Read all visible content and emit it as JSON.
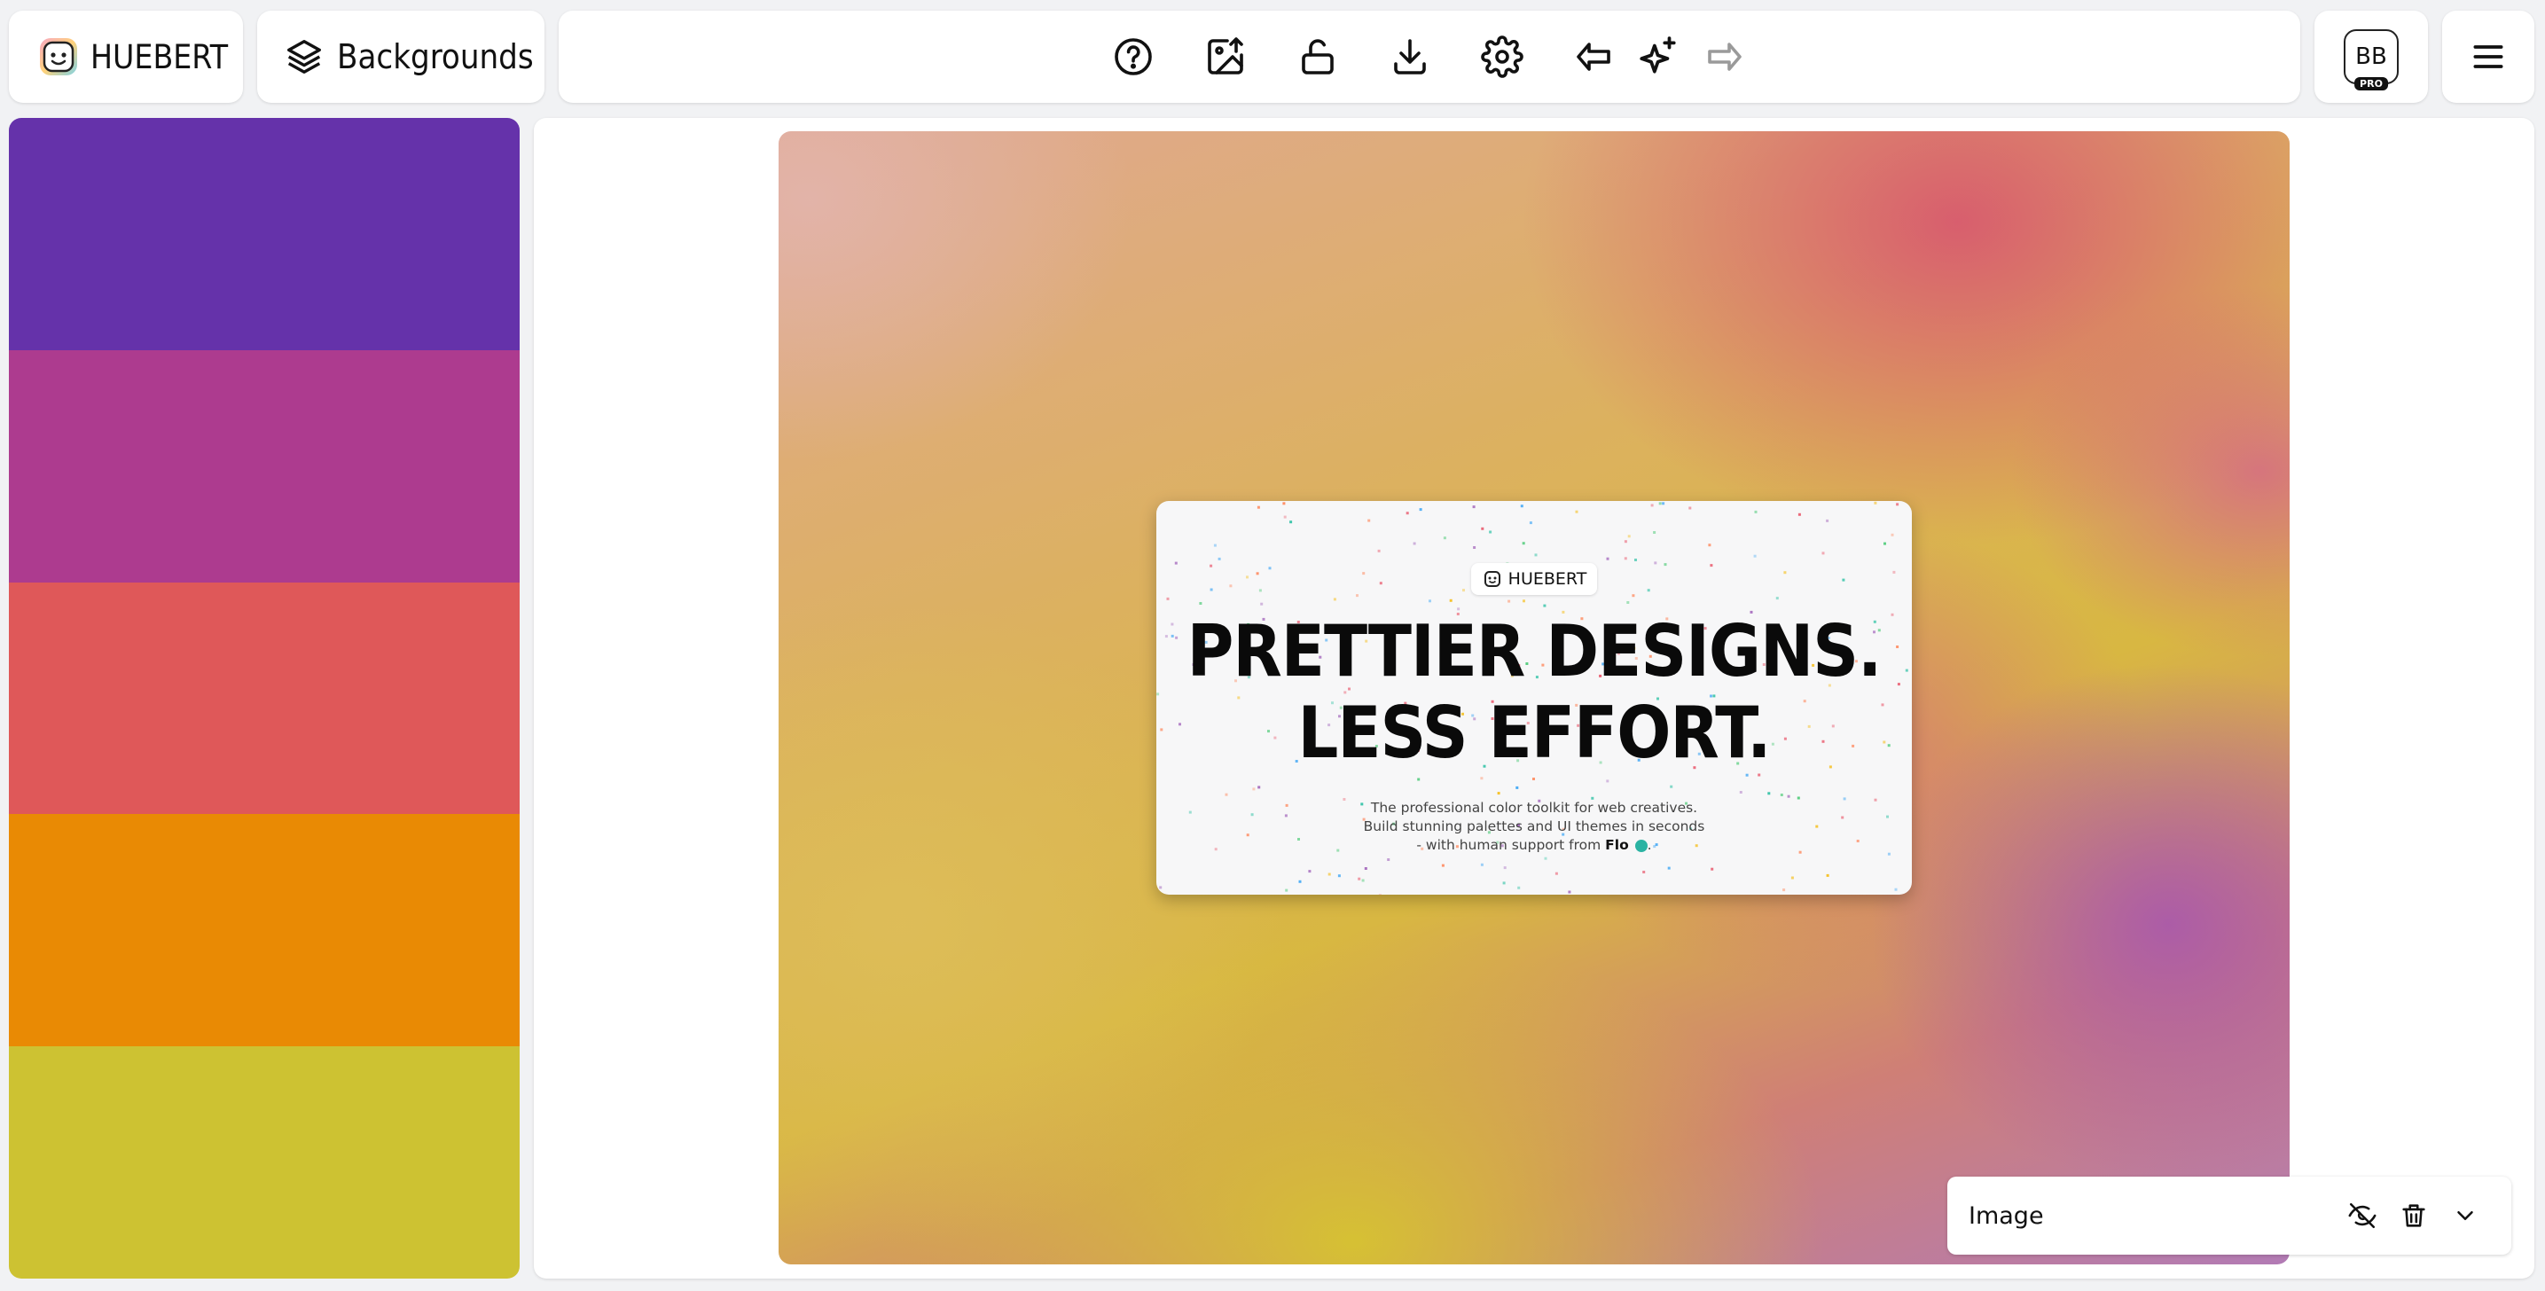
{
  "brand": {
    "name": "HUEBERT"
  },
  "nav": {
    "backgrounds_label": "Backgrounds"
  },
  "toolbar": {
    "icons": [
      "help-icon",
      "upload-image-icon",
      "unlock-icon",
      "download-icon",
      "settings-icon",
      "undo-icon",
      "sparkles-icon",
      "redo-icon"
    ]
  },
  "user": {
    "initials": "BB",
    "plan_badge": "PRO"
  },
  "palette": {
    "colors": [
      "#6532AA",
      "#AD3B8F",
      "#DF5859",
      "#E98A04",
      "#CDC232"
    ]
  },
  "preview": {
    "brand": "HUEBERT",
    "headline_line1": "PRETTIER DESIGNS.",
    "headline_line2": "LESS EFFORT.",
    "sub_line1": "The professional color toolkit for web creatives.",
    "sub_line2": "Build stunning palettes and UI themes in seconds",
    "sub_line3_prefix": "- with human support from",
    "sub_line3_name": "Flo",
    "sub_line3_suffix": "."
  },
  "layer_panel": {
    "label": "Image"
  }
}
